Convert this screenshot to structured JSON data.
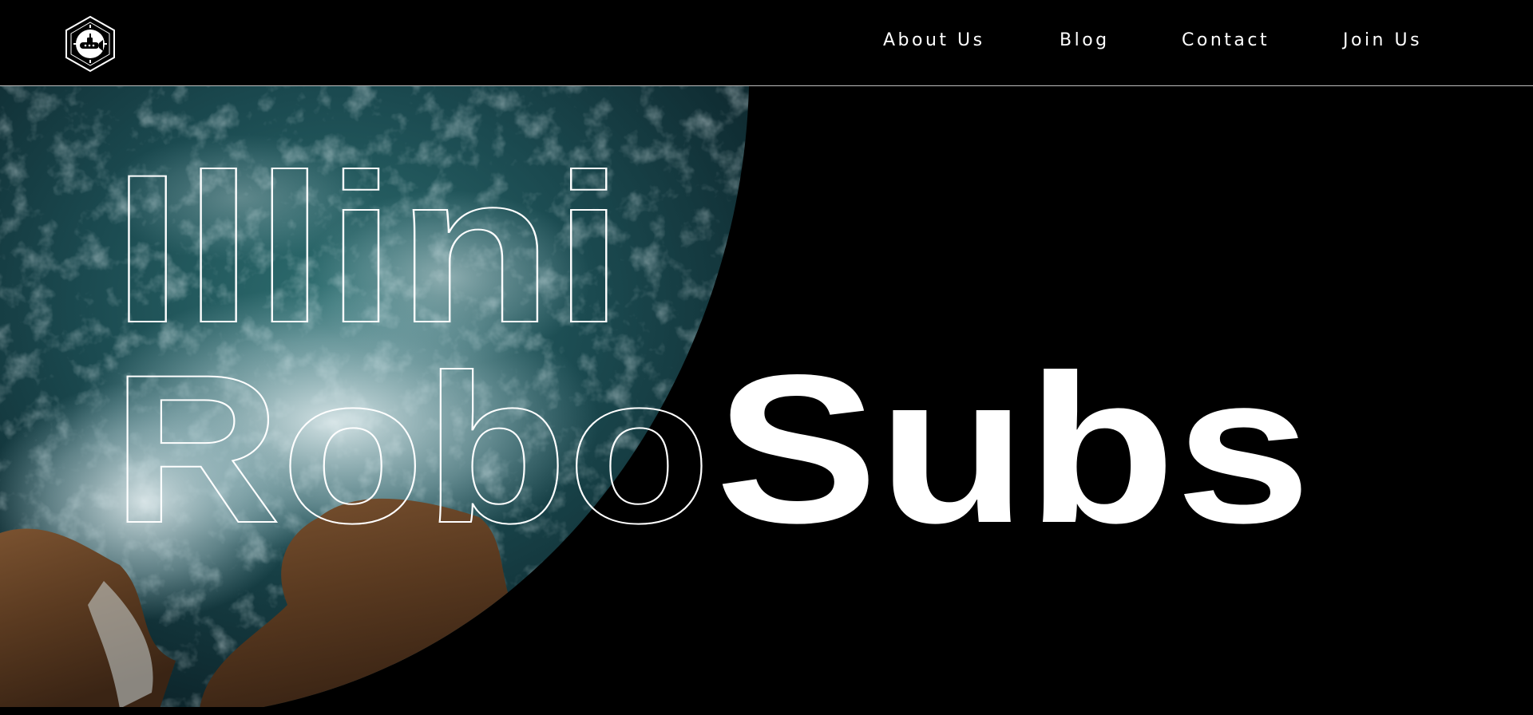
{
  "header": {
    "logo_icon": "submarine-hexagon-logo-icon",
    "nav": [
      {
        "label": "About Us"
      },
      {
        "label": "Blog"
      },
      {
        "label": "Contact"
      },
      {
        "label": "Join Us"
      }
    ]
  },
  "hero": {
    "line1": "Illini",
    "line2_outline": "Robo",
    "line2_solid": "Subs",
    "background_image": "ocean-waves-rocks-aerial"
  },
  "colors": {
    "background": "#000000",
    "text": "#ffffff",
    "divider": "#bdbdbd"
  }
}
